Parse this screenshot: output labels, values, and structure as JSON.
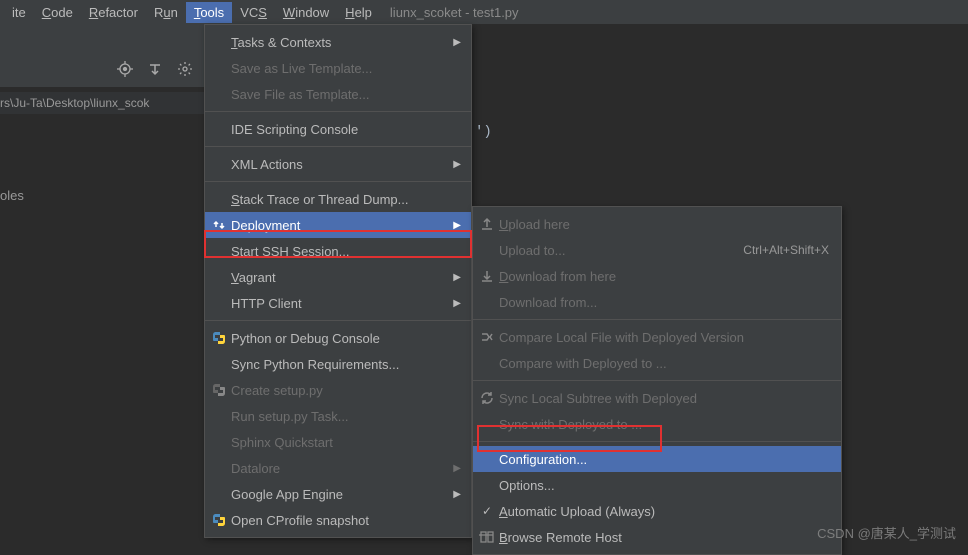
{
  "menubar": {
    "items": [
      {
        "pre": "",
        "u": "",
        "post": "ite"
      },
      {
        "pre": "",
        "u": "C",
        "post": "ode"
      },
      {
        "pre": "",
        "u": "R",
        "post": "efactor"
      },
      {
        "pre": "R",
        "u": "u",
        "post": "n"
      },
      {
        "pre": "",
        "u": "T",
        "post": "ools"
      },
      {
        "pre": "VC",
        "u": "S",
        "post": ""
      },
      {
        "pre": "",
        "u": "W",
        "post": "indow"
      },
      {
        "pre": "",
        "u": "H",
        "post": "elp"
      }
    ],
    "active_index": 4,
    "window_title": "liunx_scoket - test1.py"
  },
  "path_bar": "rs\\Ju-Ta\\Desktop\\liunx_scok",
  "side_label": "oles",
  "editor_fragment": "')",
  "tools_menu": [
    {
      "type": "item",
      "label": "Tasks & Contexts",
      "u": "T",
      "arrow": true
    },
    {
      "type": "item",
      "label": "Save as Live Template...",
      "disabled": true
    },
    {
      "type": "item",
      "label": "Save File as Template...",
      "disabled": true
    },
    {
      "type": "sep"
    },
    {
      "type": "item",
      "label": "IDE Scripting Console"
    },
    {
      "type": "sep"
    },
    {
      "type": "item",
      "label": "XML Actions",
      "arrow": true
    },
    {
      "type": "sep"
    },
    {
      "type": "item",
      "label": "Stack Trace or Thread Dump...",
      "u": "S"
    },
    {
      "type": "item",
      "label": "Deployment",
      "u": "D",
      "arrow": true,
      "highlight": true,
      "icon": "deploy"
    },
    {
      "type": "item",
      "label": "Start SSH Session..."
    },
    {
      "type": "item",
      "label": "Vagrant",
      "u": "V",
      "arrow": true
    },
    {
      "type": "item",
      "label": "HTTP Client",
      "arrow": true
    },
    {
      "type": "sep"
    },
    {
      "type": "item",
      "label": "Python or Debug Console",
      "icon": "python"
    },
    {
      "type": "item",
      "label": "Sync Python Requirements..."
    },
    {
      "type": "item",
      "label": "Create setup.py",
      "disabled": true,
      "icon": "python-gray"
    },
    {
      "type": "item",
      "label": "Run setup.py Task...",
      "disabled": true
    },
    {
      "type": "item",
      "label": "Sphinx Quickstart",
      "disabled": true
    },
    {
      "type": "item",
      "label": "Datalore",
      "disabled": true,
      "arrow": true
    },
    {
      "type": "item",
      "label": "Google App Engine",
      "arrow": true
    },
    {
      "type": "item",
      "label": "Open CProfile snapshot",
      "icon": "python"
    }
  ],
  "deployment_submenu": [
    {
      "label": "Upload here",
      "u": "U",
      "disabled": true,
      "icon": "upload"
    },
    {
      "label": "Upload to...",
      "disabled": true,
      "shortcut": "Ctrl+Alt+Shift+X"
    },
    {
      "label": "Download from here",
      "u": "D",
      "disabled": true,
      "icon": "download"
    },
    {
      "label": "Download from...",
      "disabled": true
    },
    {
      "type": "sep"
    },
    {
      "label": "Compare Local File with Deployed Version",
      "disabled": true,
      "icon": "compare"
    },
    {
      "label": "Compare with Deployed to ...",
      "disabled": true
    },
    {
      "type": "sep"
    },
    {
      "label": "Sync Local Subtree with Deployed",
      "disabled": true,
      "icon": "sync"
    },
    {
      "label": "Sync with Deployed to ...",
      "disabled": true
    },
    {
      "type": "sep"
    },
    {
      "label": "Configuration...",
      "highlight": true
    },
    {
      "label": "Options..."
    },
    {
      "label": "Automatic Upload (Always)",
      "u": "A",
      "check": true
    },
    {
      "label": "Browse Remote Host",
      "u": "B",
      "icon": "browse"
    }
  ],
  "watermark": "CSDN @唐某人_学测试"
}
